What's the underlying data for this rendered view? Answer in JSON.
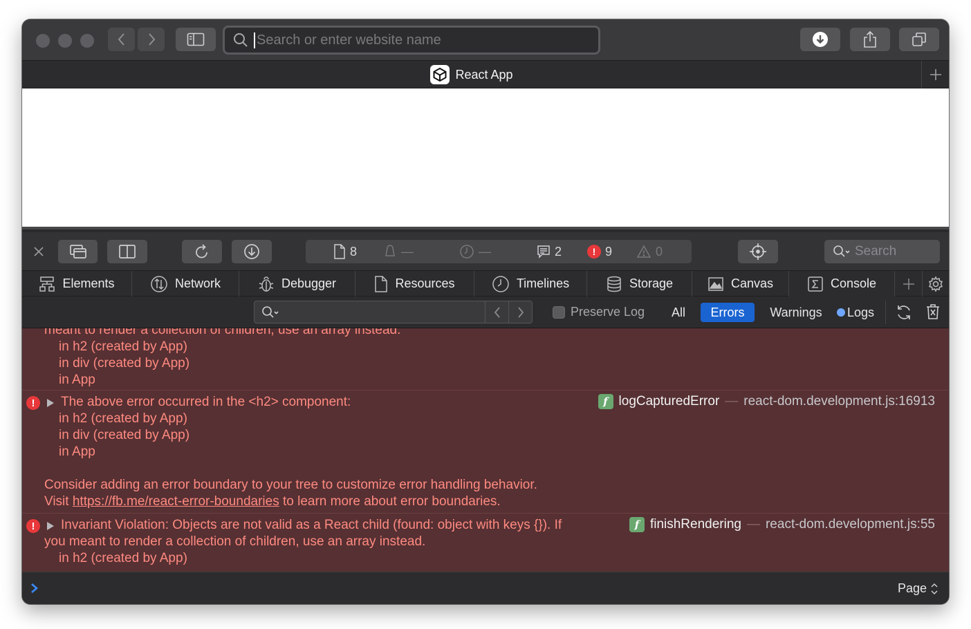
{
  "browser": {
    "address_placeholder": "Search or enter website name",
    "tab_title": "React App"
  },
  "devtools": {
    "status": {
      "resources_count": "8",
      "alerts_value": "—",
      "timer_value": "—",
      "messages_count": "2",
      "errors_count": "9",
      "warnings_count": "0"
    },
    "search_placeholder": "Search",
    "tabs": [
      {
        "label": "Elements",
        "icon": "elements-icon"
      },
      {
        "label": "Network",
        "icon": "network-icon"
      },
      {
        "label": "Debugger",
        "icon": "debugger-icon"
      },
      {
        "label": "Resources",
        "icon": "resources-icon"
      },
      {
        "label": "Timelines",
        "icon": "timelines-icon"
      },
      {
        "label": "Storage",
        "icon": "storage-icon"
      },
      {
        "label": "Canvas",
        "icon": "canvas-icon"
      },
      {
        "label": "Console",
        "icon": "console-icon"
      }
    ],
    "filter": {
      "preserve_log": "Preserve Log",
      "all": "All",
      "errors": "Errors",
      "warnings": "Warnings",
      "logs": "Logs",
      "active": "Errors"
    },
    "prompt": {
      "chevron": "›",
      "context": "Page"
    }
  },
  "console": {
    "msg0": {
      "lines": [
        "meant to render a collection of children, use an array instead.",
        "in h2 (created by App)",
        "in div (created by App)",
        "in App"
      ]
    },
    "msg1": {
      "headline": "The above error occurred in the <h2> component:",
      "lines": [
        "in h2 (created by App)",
        "in div (created by App)",
        "in App"
      ],
      "advice": "Consider adding an error boundary to your tree to customize error handling behavior.",
      "visit_prefix": "Visit ",
      "link": "https://fb.me/react-error-boundaries",
      "visit_suffix": " to learn more about error boundaries.",
      "function": "logCapturedError",
      "separator": "—",
      "source": "react-dom.development.js:16913"
    },
    "msg2": {
      "headline": "Invariant Violation: Objects are not valid as a React child (found: object with keys {}). If",
      "line2": "you meant to render a collection of children, use an array instead.",
      "line3": "in h2 (created by App)",
      "function": "finishRendering",
      "separator": "—",
      "source": "react-dom.development.js:55"
    }
  },
  "colors": {
    "error_text": "#ff8a80",
    "error_background": "#563033",
    "active_filter": "#1a64d2"
  }
}
